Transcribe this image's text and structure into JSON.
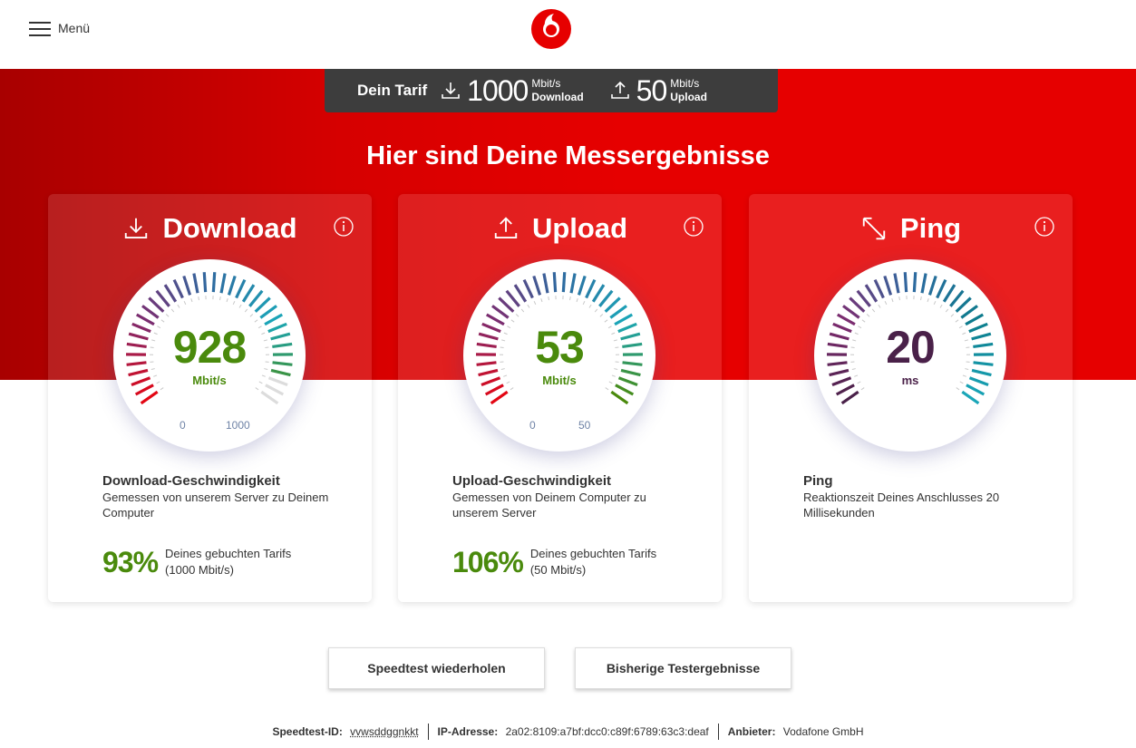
{
  "header": {
    "menu_label": "Menü",
    "logo": "vodafone-logo"
  },
  "tarif": {
    "label": "Dein Tarif",
    "download_value": "1000",
    "download_unit": "Mbit/s",
    "download_label": "Download",
    "upload_value": "50",
    "upload_unit": "Mbit/s",
    "upload_label": "Upload"
  },
  "headline": "Hier sind Deine Messergebnisse",
  "colors": {
    "brand_red": "#e60000",
    "download_value": "#4a8a0c",
    "ping_value": "#4a2149",
    "tarif_bg": "#3d3d3d"
  },
  "cards": {
    "download": {
      "title": "Download",
      "icon": "download-icon",
      "value": "928",
      "unit": "Mbit/s",
      "gauge_fraction": 0.928,
      "scale_min": "0",
      "scale_max": "1000",
      "desc_title": "Download-Geschwindigkeit",
      "desc_text": "Gemessen von unserem Server zu Deinem Computer",
      "percent": "93%",
      "percent_text_1": "Deines gebuchten Tarifs",
      "percent_text_2": "(1000 Mbit/s)"
    },
    "upload": {
      "title": "Upload",
      "icon": "upload-icon",
      "value": "53",
      "unit": "Mbit/s",
      "gauge_fraction": 1.0,
      "scale_min": "0",
      "scale_max": "50",
      "desc_title": "Upload-Geschwindigkeit",
      "desc_text": "Gemessen von Deinem Computer zu unserem Server",
      "percent": "106%",
      "percent_text_1": "Deines gebuchten Tarifs",
      "percent_text_2": "(50 Mbit/s)"
    },
    "ping": {
      "title": "Ping",
      "icon": "ping-icon",
      "value": "20",
      "unit": "ms",
      "gauge_fraction": 1.0,
      "desc_title": "Ping",
      "desc_text": "Reaktionszeit Deines Anschlusses 20 Millisekunden"
    }
  },
  "buttons": {
    "repeat": "Speedtest wiederholen",
    "history": "Bisherige Testergebnisse"
  },
  "footer": {
    "id_label": "Speedtest-ID:",
    "id_value": "vvwsddggnkkt",
    "ip_label": "IP-Adresse:",
    "ip_value": "2a02:8109:a7bf:dcc0:c89f:6789:63c3:deaf",
    "provider_label": "Anbieter:",
    "provider_value": "Vodafone GmbH"
  }
}
